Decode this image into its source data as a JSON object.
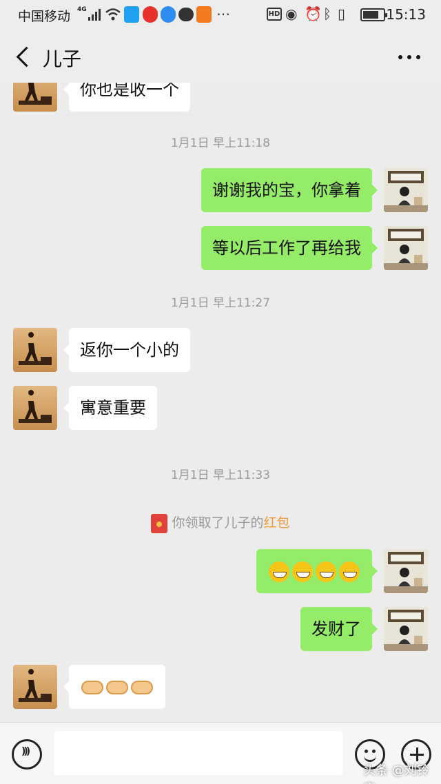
{
  "status_bar": {
    "carrier": "中国移动",
    "network": "4G",
    "time": "15:13",
    "hd_label": "HD",
    "battery_level": 0.8
  },
  "nav": {
    "title": "儿子"
  },
  "messages": [
    {
      "type": "text",
      "sender": "son",
      "text": "你也是收一个"
    },
    {
      "type": "timestamp",
      "text": "1月1日 早上11:18"
    },
    {
      "type": "text",
      "sender": "me",
      "text": "谢谢我的宝，你拿着"
    },
    {
      "type": "text",
      "sender": "me",
      "text": "等以后工作了再给我"
    },
    {
      "type": "timestamp",
      "text": "1月1日 早上11:27"
    },
    {
      "type": "text",
      "sender": "son",
      "text": "返你一个小的"
    },
    {
      "type": "text",
      "sender": "son",
      "text": "寓意重要"
    },
    {
      "type": "timestamp",
      "text": "1月1日 早上11:33"
    },
    {
      "type": "system",
      "text": "你领取了儿子的",
      "link": "红包"
    },
    {
      "type": "emoji",
      "sender": "me",
      "emoji_name": "grin-emoji",
      "count": 4
    },
    {
      "type": "text",
      "sender": "me",
      "text": "发财了"
    },
    {
      "type": "emoji",
      "sender": "son",
      "emoji_name": "handshake-emoji",
      "count": 3
    }
  ],
  "watermark": "头条 @刘铃言",
  "colors": {
    "my_bubble": "#95ec69",
    "their_bubble": "#ffffff",
    "background": "#ececec",
    "link": "#f09a37"
  }
}
